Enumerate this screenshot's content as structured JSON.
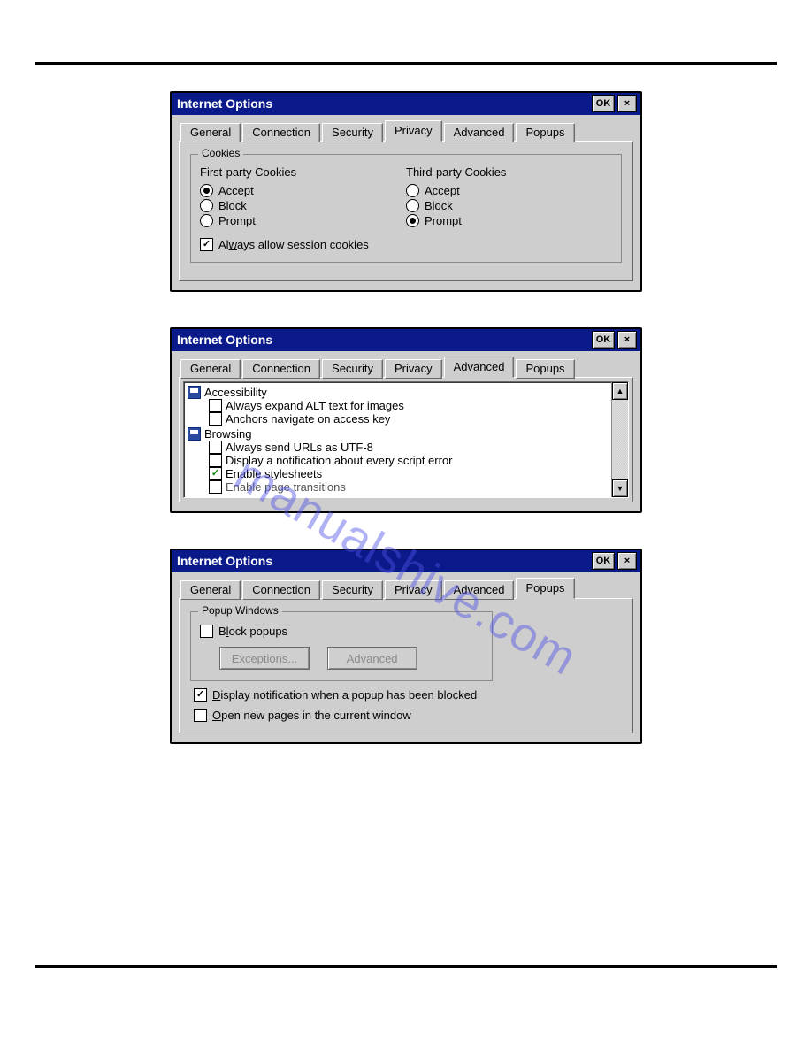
{
  "dialog": {
    "title": "Internet Options",
    "ok": "OK",
    "close": "×"
  },
  "tabs": {
    "general": "General",
    "connection": "Connection",
    "security": "Security",
    "privacy": "Privacy",
    "advanced": "Advanced",
    "popups": "Popups"
  },
  "privacy": {
    "group": "Cookies",
    "first_party": "First-party Cookies",
    "third_party": "Third-party Cookies",
    "accept_u": "A",
    "accept_rest": "ccept",
    "block_u": "B",
    "block_rest": "lock",
    "prompt_u": "P",
    "prompt_rest": "rompt",
    "accept": "Accept",
    "block": "Block",
    "prompt": "Prompt",
    "always_pre": "Al",
    "always_u": "w",
    "always_post": "ays allow session cookies"
  },
  "advanced": {
    "cat_accessibility": "Accessibility",
    "alt_text": "Always expand ALT text for images",
    "anchors": "Anchors navigate on access key",
    "cat_browsing": "Browsing",
    "utf8": "Always send URLs as UTF-8",
    "script_error": "Display a notification about every script error",
    "stylesheets": "Enable stylesheets",
    "page_transitions": "Enable page transitions"
  },
  "popups": {
    "group": "Popup Windows",
    "block_u": "l",
    "block_pre": "B",
    "block_post": "ock popups",
    "exceptions_u": "E",
    "exceptions_rest": "xceptions...",
    "advanced_u": "A",
    "advanced_rest": "dvanced",
    "notify_u": "D",
    "notify_rest": "isplay notification when a popup has been blocked",
    "open_u": "O",
    "open_rest": "pen new pages in the current window"
  },
  "watermark": "manualshive.com",
  "scroll": {
    "up": "▲",
    "down": "▼"
  }
}
